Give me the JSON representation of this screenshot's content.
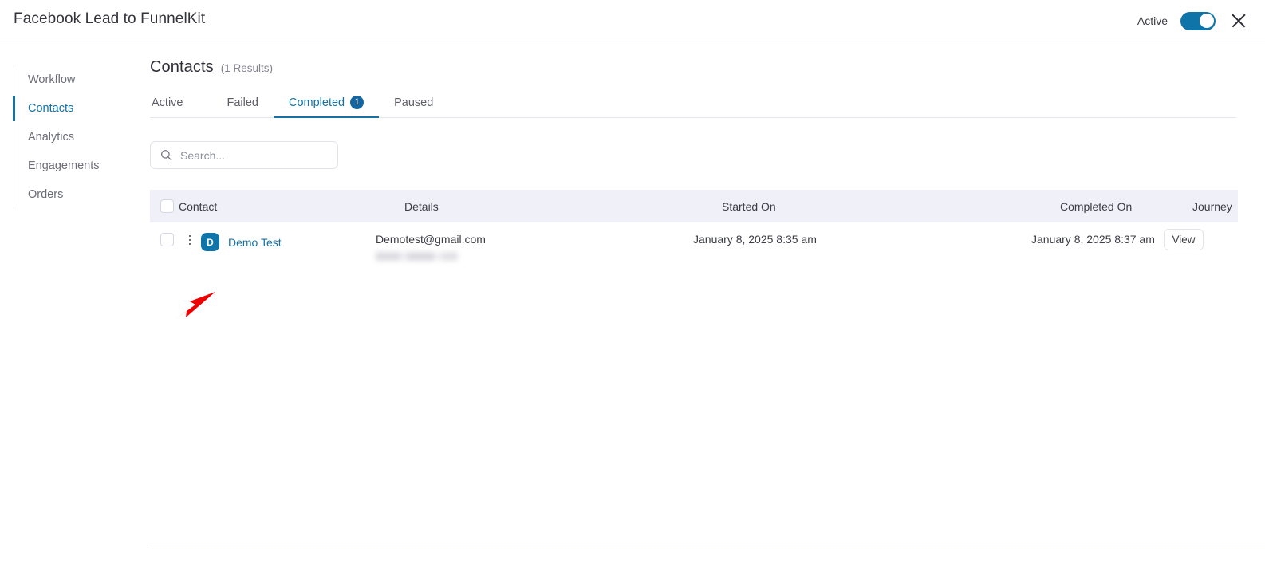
{
  "window": {
    "title": "Facebook Lead to FunnelKit",
    "status_label": "Active",
    "toggle_state": "on",
    "close_icon": "close-icon",
    "accent_color": "#1473a4",
    "toggle_color": "#0f74a8"
  },
  "sidebar": {
    "items": [
      {
        "label": "Workflow",
        "active": false
      },
      {
        "label": "Contacts",
        "active": true
      },
      {
        "label": "Analytics",
        "active": false
      },
      {
        "label": "Engagements",
        "active": false
      },
      {
        "label": "Orders",
        "active": false
      }
    ]
  },
  "main": {
    "page_title": "Contacts",
    "results_count": "(1 Results)",
    "tabs": [
      {
        "label": "Active",
        "badge": "",
        "active": false
      },
      {
        "label": "Failed",
        "badge": "",
        "active": false
      },
      {
        "label": "Completed",
        "badge": "1",
        "active": true
      },
      {
        "label": "Paused",
        "badge": "",
        "active": false
      }
    ],
    "search": {
      "value": "",
      "placeholder": "Search...",
      "icon": "search-icon"
    },
    "table": {
      "columns": [
        "Contact",
        "Details",
        "Started On",
        "Completed On",
        "Journey"
      ],
      "rows": [
        {
          "avatar_initial": "D",
          "contact_name": "Demo Test",
          "details_email": "Demotest@gmail.com",
          "details_secondary_redacted": true,
          "started_on": "January 8, 2025 8:35 am",
          "completed_on": "January 8, 2025 8:37 am",
          "journey_action": "View"
        }
      ]
    }
  },
  "annotation": {
    "arrow_color": "#ef0000",
    "points_to": "row-actions-menu"
  }
}
